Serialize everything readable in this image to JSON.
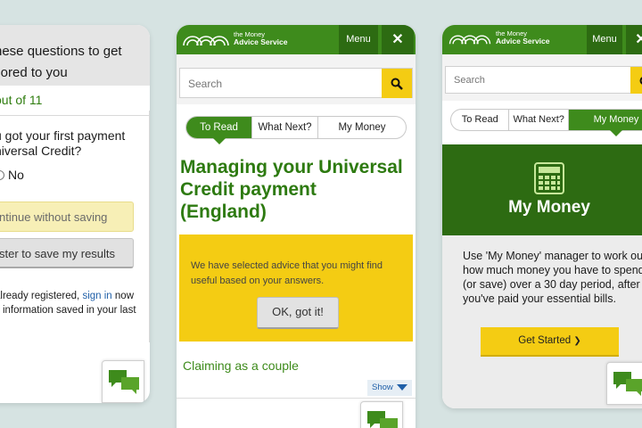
{
  "colors": {
    "brand_green": "#3e8b1c",
    "dark_green": "#2d6b12",
    "accent_yellow": "#f4cc13",
    "background": "#d6e3e2"
  },
  "left_screen": {
    "header_line1": "hese questions to get",
    "header_line2": "ilored to you",
    "progress": "out of 11",
    "question_line1": "u got your first payment",
    "question_line2": "niversal Credit?",
    "option_no": "No",
    "continue_button": "ntinue without saving",
    "register_button": "ster to save my results",
    "login_note_before": "already registered, ",
    "login_note_link": "sign in",
    "login_note_after": " now",
    "login_note_line2": "v information saved in your last",
    "chat_icon": "chat-bubbles-icon"
  },
  "middle_screen": {
    "logo_line1": "the Money",
    "logo_line2": "Advice Service",
    "menu_label": "Menu",
    "close_label": "✕",
    "search_placeholder": "Search",
    "tabs": [
      {
        "label": "To Read",
        "active": true
      },
      {
        "label": "What Next?",
        "active": false
      },
      {
        "label": "My Money",
        "active": false
      }
    ],
    "page_title": "Managing your Universal Credit payment (England)",
    "notice_text": "We have selected advice that you might find useful based on your answers.",
    "ok_button": "OK, got it!",
    "subheading": "Claiming as a couple",
    "show_toggle": "Show",
    "chat_icon": "chat-bubbles-icon"
  },
  "right_screen": {
    "logo_line1": "the Money",
    "logo_line2": "Advice Service",
    "menu_label": "Menu",
    "close_label": "✕",
    "search_placeholder": "Search",
    "tabs": [
      {
        "label": "To Read",
        "active": false
      },
      {
        "label": "What Next?",
        "active": false
      },
      {
        "label": "My Money",
        "active": true
      }
    ],
    "panel_title": "My Money",
    "panel_icon": "calculator-icon",
    "description": "Use 'My Money' manager to work out how much money you have to spend (or save) over a 30 day period, after you've paid your essential bills.",
    "start_button": "Get Started",
    "start_arrow": "❯",
    "chat_icon": "chat-bubbles-icon"
  }
}
